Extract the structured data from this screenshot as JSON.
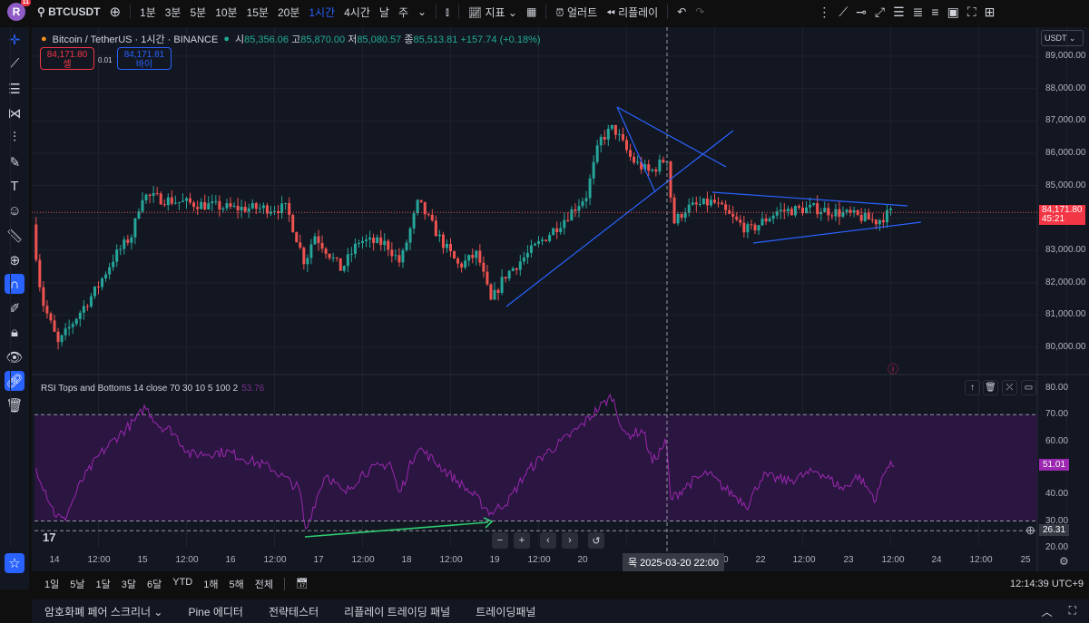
{
  "topbar": {
    "avatar_letter": "R",
    "notif_count": "11",
    "symbol": "BTCUSDT",
    "intervals": [
      "1분",
      "3분",
      "5분",
      "10분",
      "15분",
      "20분",
      "1시간",
      "4시간",
      "날",
      "주"
    ],
    "active_interval": "1시간",
    "indicators_label": "지표",
    "alert_label": "얼러트",
    "replay_label": "리플레이"
  },
  "legend": {
    "title": "Bitcoin / TetherUS · 1시간 · BINANCE",
    "o_label": "시",
    "o": "85,356.06",
    "h_label": "고",
    "h": "85,870.00",
    "l_label": "저",
    "l": "85,080.57",
    "c_label": "종",
    "c": "85,513.81",
    "change": "+157.74 (+0.18%)",
    "sell_price": "84,171.80",
    "sell_label": "셀",
    "spread": "0.01",
    "buy_price": "84,171.81",
    "buy_label": "바이"
  },
  "currency": "USDT",
  "price_axis": [
    "89,000.00",
    "88,000.00",
    "87,000.00",
    "86,000.00",
    "85,000.00",
    "84,000.00",
    "83,000.00",
    "82,000.00",
    "81,000.00",
    "80,000.00"
  ],
  "last_price": "84,171.80",
  "countdown": "45:21",
  "rsi": {
    "legend": "RSI Tops and Bottoms 14 close 70 30 10 5 100 2",
    "legend_value": "53.76",
    "axis": [
      "80.00",
      "70.00",
      "60.00",
      "40.00",
      "30.00",
      "20.00"
    ],
    "current": "51.01",
    "crosshair_value": "26.31",
    "upper": 70,
    "lower": 30
  },
  "time_axis": [
    "14",
    "12:00",
    "15",
    "12:00",
    "16",
    "12:00",
    "17",
    "12:00",
    "18",
    "12:00",
    "19",
    "12:00",
    "20",
    "12:00",
    "22",
    "12:00",
    "23",
    "12:00",
    "24",
    "12:00",
    "25"
  ],
  "crosshair_time": "목 2025-03-20  22:00",
  "ranges": [
    "1일",
    "5날",
    "1달",
    "3달",
    "6달",
    "YTD",
    "1해",
    "5해",
    "전체"
  ],
  "clock": "12:14:39 UTC+9",
  "footer": {
    "tabs": [
      "암호화폐 페어 스크리너",
      "Pine 에디터",
      "전략테스터",
      "리플레이 트레이딩 패널",
      "트레이딩패널"
    ]
  },
  "colors": {
    "up": "#26a69a",
    "down": "#ef5350",
    "rsi": "#9c27b0",
    "drawing": "#2962ff",
    "arrow": "#2ecc71",
    "bg": "#131722"
  },
  "price_path": [
    [
      -5,
      83800
    ],
    [
      -2.5,
      81500
    ],
    [
      2,
      80100
    ],
    [
      7.4,
      81000
    ],
    [
      12.4,
      81800
    ],
    [
      17.3,
      82800
    ],
    [
      22.3,
      83500
    ],
    [
      24.7,
      84700
    ],
    [
      34.6,
      84500
    ],
    [
      49.5,
      84300
    ],
    [
      64.3,
      84300
    ],
    [
      69.3,
      82600
    ],
    [
      71.8,
      83500
    ],
    [
      79.2,
      82400
    ],
    [
      84.1,
      83300
    ],
    [
      91.5,
      83200
    ],
    [
      95.3,
      82600
    ],
    [
      100.2,
      84500
    ],
    [
      106.4,
      83300
    ],
    [
      111.3,
      82500
    ],
    [
      116.3,
      82900
    ],
    [
      120,
      81400
    ],
    [
      123.7,
      82200
    ],
    [
      131.1,
      83000
    ],
    [
      138.6,
      83800
    ],
    [
      146,
      84700
    ],
    [
      149.7,
      86400
    ],
    [
      153.4,
      86800
    ],
    [
      158.4,
      85800
    ],
    [
      163.3,
      85400
    ],
    [
      168.3,
      85900
    ],
    [
      169.5,
      83800
    ],
    [
      173.2,
      84300
    ],
    [
      180.6,
      84500
    ],
    [
      185.6,
      84000
    ],
    [
      190.5,
      83600
    ],
    [
      198,
      84200
    ],
    [
      207.9,
      84300
    ],
    [
      217.8,
      84100
    ],
    [
      225.2,
      83900
    ],
    [
      228.9,
      84170
    ]
  ],
  "rsi_path": [
    [
      -5,
      50
    ],
    [
      0,
      33
    ],
    [
      2.5,
      30
    ],
    [
      7.4,
      45
    ],
    [
      12.4,
      55
    ],
    [
      17.3,
      62
    ],
    [
      22.3,
      68
    ],
    [
      24.7,
      73
    ],
    [
      28.5,
      66
    ],
    [
      32,
      64
    ],
    [
      37,
      55
    ],
    [
      47,
      56
    ],
    [
      59,
      50
    ],
    [
      66.8,
      42
    ],
    [
      68.5,
      26
    ],
    [
      70.5,
      35
    ],
    [
      74,
      48
    ],
    [
      79,
      40
    ],
    [
      84,
      48
    ],
    [
      91.5,
      52
    ],
    [
      94,
      40
    ],
    [
      99,
      58
    ],
    [
      104,
      52
    ],
    [
      109,
      46
    ],
    [
      114,
      40
    ],
    [
      119,
      33
    ],
    [
      124,
      38
    ],
    [
      128.5,
      48
    ],
    [
      133.5,
      55
    ],
    [
      138.5,
      60
    ],
    [
      143,
      65
    ],
    [
      148,
      72
    ],
    [
      152,
      77
    ],
    [
      155.5,
      62
    ],
    [
      160.5,
      64
    ],
    [
      163,
      52
    ],
    [
      166.8,
      60
    ],
    [
      168,
      38
    ],
    [
      173,
      44
    ],
    [
      178,
      48
    ],
    [
      183,
      42
    ],
    [
      189,
      36
    ],
    [
      193,
      47
    ],
    [
      200,
      45
    ],
    [
      208,
      49
    ],
    [
      215,
      42
    ],
    [
      219,
      47
    ],
    [
      224,
      38
    ],
    [
      226.5,
      50
    ],
    [
      229,
      51
    ]
  ]
}
